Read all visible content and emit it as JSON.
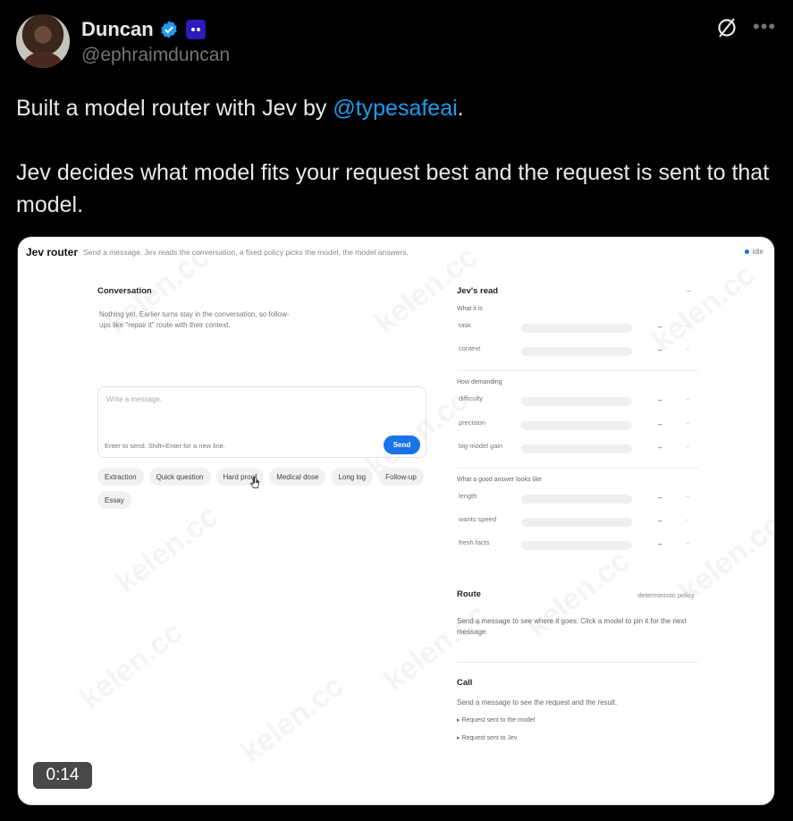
{
  "author": {
    "name": "Duncan",
    "handle": "@ephraimduncan"
  },
  "tweet": {
    "line1_before": "Built a model router with Jev by ",
    "mention": "@typesafeai",
    "line1_after": ".",
    "line2": "Jev decides what model fits your request best and the request is sent to that model."
  },
  "icons": {
    "verified": "verified-badge-icon",
    "affiliation": "affiliation-icon",
    "grok": "grok-icon",
    "more": "more-options-icon",
    "cursor": "pointer-cursor-icon"
  },
  "colors": {
    "accent": "#1d9bf0",
    "send": "#1a73e8"
  },
  "video": {
    "time": "0:14"
  },
  "app": {
    "title": "Jev router",
    "subtitle": "Send a message. Jev reads the conversation, a fixed policy picks the model, the model answers.",
    "status": "idle",
    "conversation": {
      "title": "Conversation",
      "empty": "Nothing yet. Earlier turns stay in the conversation, so follow-ups like \"repair it\" route with their context."
    },
    "composer": {
      "placeholder": "Write a message.",
      "hint": "Enter to send. Shift+Enter for a new line.",
      "send": "Send"
    },
    "chips": [
      "Extraction",
      "Quick question",
      "Hard proof",
      "Medical dose",
      "Long log",
      "Follow-up",
      "Essay"
    ],
    "read": {
      "title": "Jev's read",
      "dash": "–",
      "groups": [
        {
          "label": "What it is",
          "rows": [
            "task",
            "context"
          ]
        },
        {
          "label": "How demanding",
          "rows": [
            "difficulty",
            "precision",
            "big-model gain"
          ]
        },
        {
          "label": "What a good answer looks like",
          "rows": [
            "length",
            "wants speed",
            "fresh facts"
          ]
        }
      ],
      "row_dash": "–",
      "row_dash2": "–"
    },
    "route": {
      "title": "Route",
      "policy": "deterministic policy",
      "text": "Send a message to see where it goes. Click a model to pin it for the next message."
    },
    "call": {
      "title": "Call",
      "text": "Send a message to see the request and the result.",
      "links": [
        "▸ Request sent to the model",
        "▸ Request sent to Jev"
      ]
    },
    "watermark": "kelen.cc"
  }
}
